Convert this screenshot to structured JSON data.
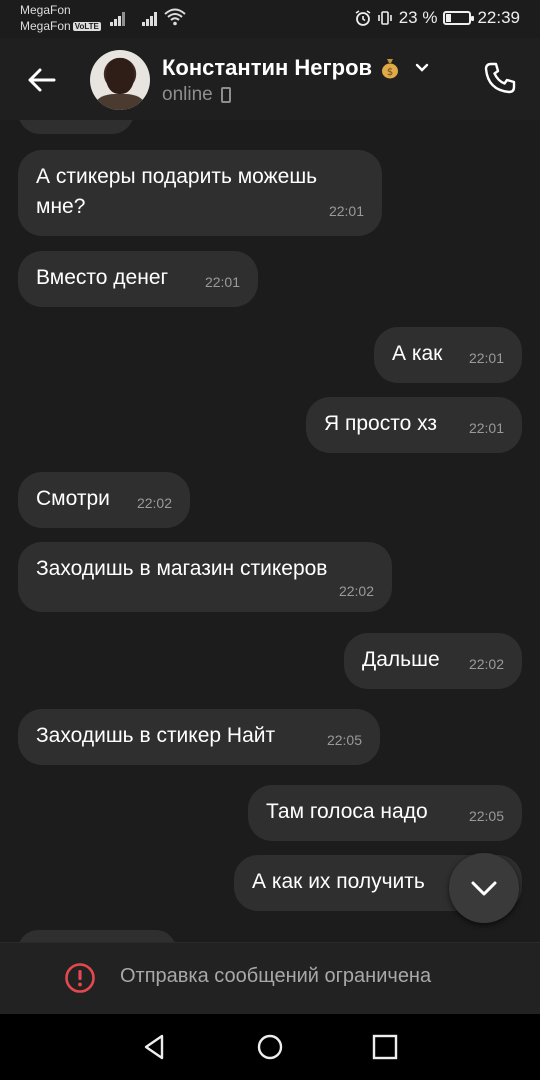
{
  "status_bar": {
    "carrier1": "MegaFon",
    "carrier2": "MegaFon",
    "volte": "VoLTE",
    "battery": "23 %",
    "battery_level": 0.23,
    "time": "22:39",
    "icons": [
      "signal-icon",
      "signal-icon",
      "wifi-icon",
      "alarm-icon",
      "vibrate-icon",
      "battery-icon"
    ]
  },
  "header": {
    "contact_name": "Константин Негров",
    "contact_emoji": "money-bag-icon",
    "presence": "online",
    "icons": [
      "back-arrow-icon",
      "chevron-down-icon",
      "mobile-phone-icon",
      "phone-call-icon"
    ]
  },
  "messages": [
    {
      "side": "in",
      "text": "А стикеры подарить можешь\nмне?",
      "time": "22:01"
    },
    {
      "side": "in",
      "text": "Вместо денег",
      "time": "22:01"
    },
    {
      "side": "out",
      "text": "А как",
      "time": "22:01"
    },
    {
      "side": "out",
      "text": "Я просто хз",
      "time": "22:01"
    },
    {
      "side": "in",
      "text": "Смотри",
      "time": "22:02"
    },
    {
      "side": "in",
      "text": "Заходишь в магазин стикеров",
      "time": "22:02"
    },
    {
      "side": "out",
      "text": "Дальше",
      "time": "22:02"
    },
    {
      "side": "in",
      "text": "Заходишь в стикер Найт",
      "time": "22:05"
    },
    {
      "side": "out",
      "text": "Там голоса надо",
      "time": "22:05"
    },
    {
      "side": "out",
      "text": "А как их получить",
      "time": ""
    }
  ],
  "footer": {
    "restriction_text": "Отправка сообщений ограничена",
    "icon": "warning-icon"
  },
  "colors": {
    "background": "#1c1c1c",
    "bubble": "#2f2f2f",
    "warning": "#e5484d",
    "muted_text": "#9a9a9a"
  },
  "navbar": {
    "icons": [
      "back-triangle-icon",
      "home-circle-icon",
      "recents-square-icon"
    ]
  }
}
